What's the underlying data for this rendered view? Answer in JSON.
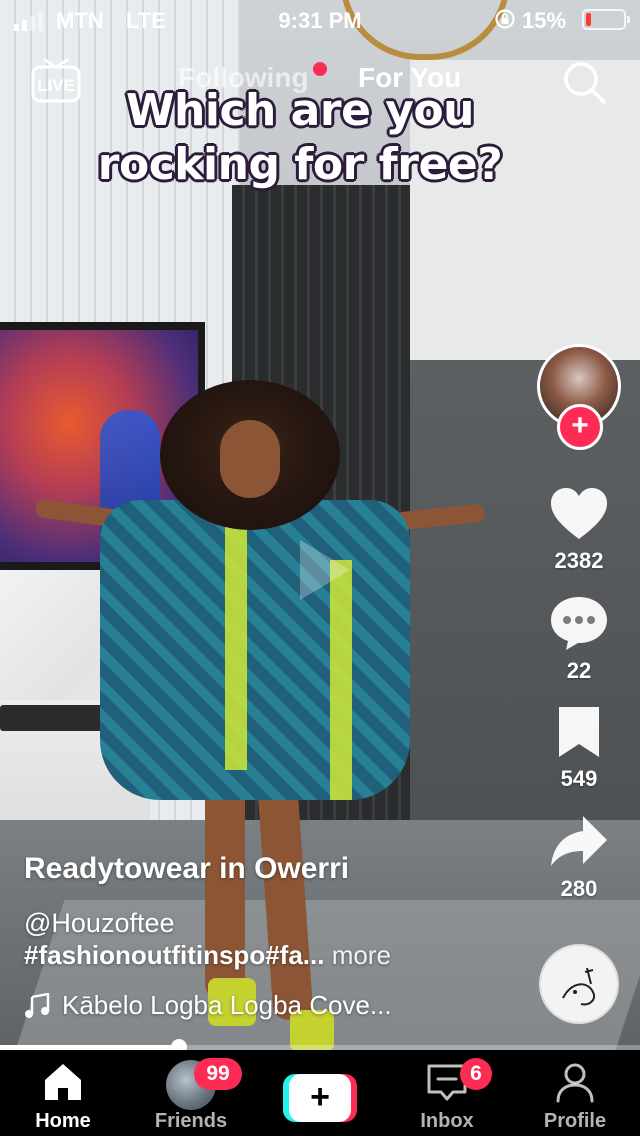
{
  "status_bar": {
    "carrier": "MTN",
    "network": "LTE",
    "time": "9:31 PM",
    "battery_percent": "15%",
    "battery_level": 0.15,
    "signal_bars": 2,
    "battery_color": "#ff3b30"
  },
  "top_nav": {
    "live_label": "LIVE",
    "tabs": [
      {
        "label": "Following",
        "active": false,
        "has_dot": true
      },
      {
        "label": "For You",
        "active": true
      }
    ],
    "search_icon": "search-icon"
  },
  "video": {
    "caption_lines": [
      "Which are you",
      "rocking for free?"
    ]
  },
  "actions": {
    "likes": "2382",
    "comments": "22",
    "saves": "549",
    "shares": "280",
    "follow_symbol": "+"
  },
  "post": {
    "title": "Readytowear in Owerri",
    "username": "@Houzoftee",
    "hashtags": "#fashionoutfitinspo#fa...",
    "more_label": "more",
    "music": "Kābelo Logba Logba Cove..."
  },
  "progress": {
    "played_fraction": 0.28
  },
  "tab_bar": {
    "items": [
      {
        "label": "Home",
        "icon": "home-icon",
        "active": true
      },
      {
        "label": "Friends",
        "icon": "friends-avatar",
        "badge": "99"
      },
      {
        "label": "",
        "icon": "create-icon",
        "symbol": "+"
      },
      {
        "label": "Inbox",
        "icon": "inbox-icon",
        "badge": "6"
      },
      {
        "label": "Profile",
        "icon": "profile-icon"
      }
    ]
  },
  "colors": {
    "accent": "#fe2c55",
    "cyan": "#25f4ee"
  }
}
